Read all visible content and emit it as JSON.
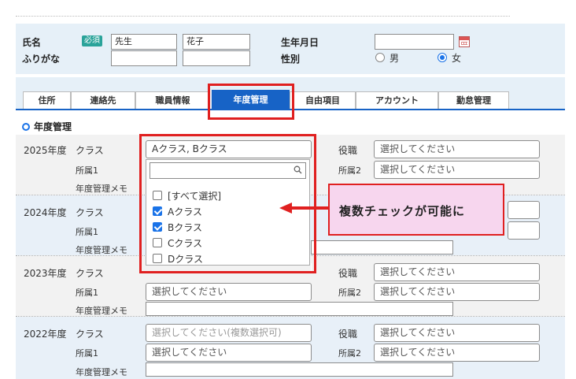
{
  "person": {
    "name_label": "氏名",
    "required_badge": "必須",
    "last_name": "先生",
    "first_name": "花子",
    "furigana_label": "ふりがな",
    "birthdate_label": "生年月日",
    "gender_label": "性別",
    "gender_options": [
      "男",
      "女"
    ],
    "gender_selected": "女"
  },
  "tabs": [
    "住所",
    "連絡先",
    "職員情報",
    "年度管理",
    "自由項目",
    "アカウント",
    "勤怠管理"
  ],
  "active_tab": "年度管理",
  "section_title": "年度管理",
  "field_labels": {
    "class": "クラス",
    "dept1": "所属1",
    "memo": "年度管理メモ",
    "role": "役職",
    "dept2": "所属2"
  },
  "placeholder_select": "選択してください",
  "placeholder_multi": "選択してください(複数選択可)",
  "years": [
    {
      "year": "2025年度",
      "class_value": "Aクラス, Bクラス"
    },
    {
      "year": "2024年度"
    },
    {
      "year": "2023年度"
    },
    {
      "year": "2022年度"
    }
  ],
  "dropdown": {
    "search_value": "",
    "options": [
      {
        "label": "[すべて選択]",
        "checked": false
      },
      {
        "label": "Aクラス",
        "checked": true
      },
      {
        "label": "Bクラス",
        "checked": true
      },
      {
        "label": "Cクラス",
        "checked": false
      },
      {
        "label": "Dクラス",
        "checked": false
      }
    ]
  },
  "callout": "複数チェックが可能に",
  "colors": {
    "accent": "#1763c6",
    "highlight_border": "#e02020",
    "callout_bg": "#f7d6ee",
    "required_badge": "#2aa39a"
  }
}
